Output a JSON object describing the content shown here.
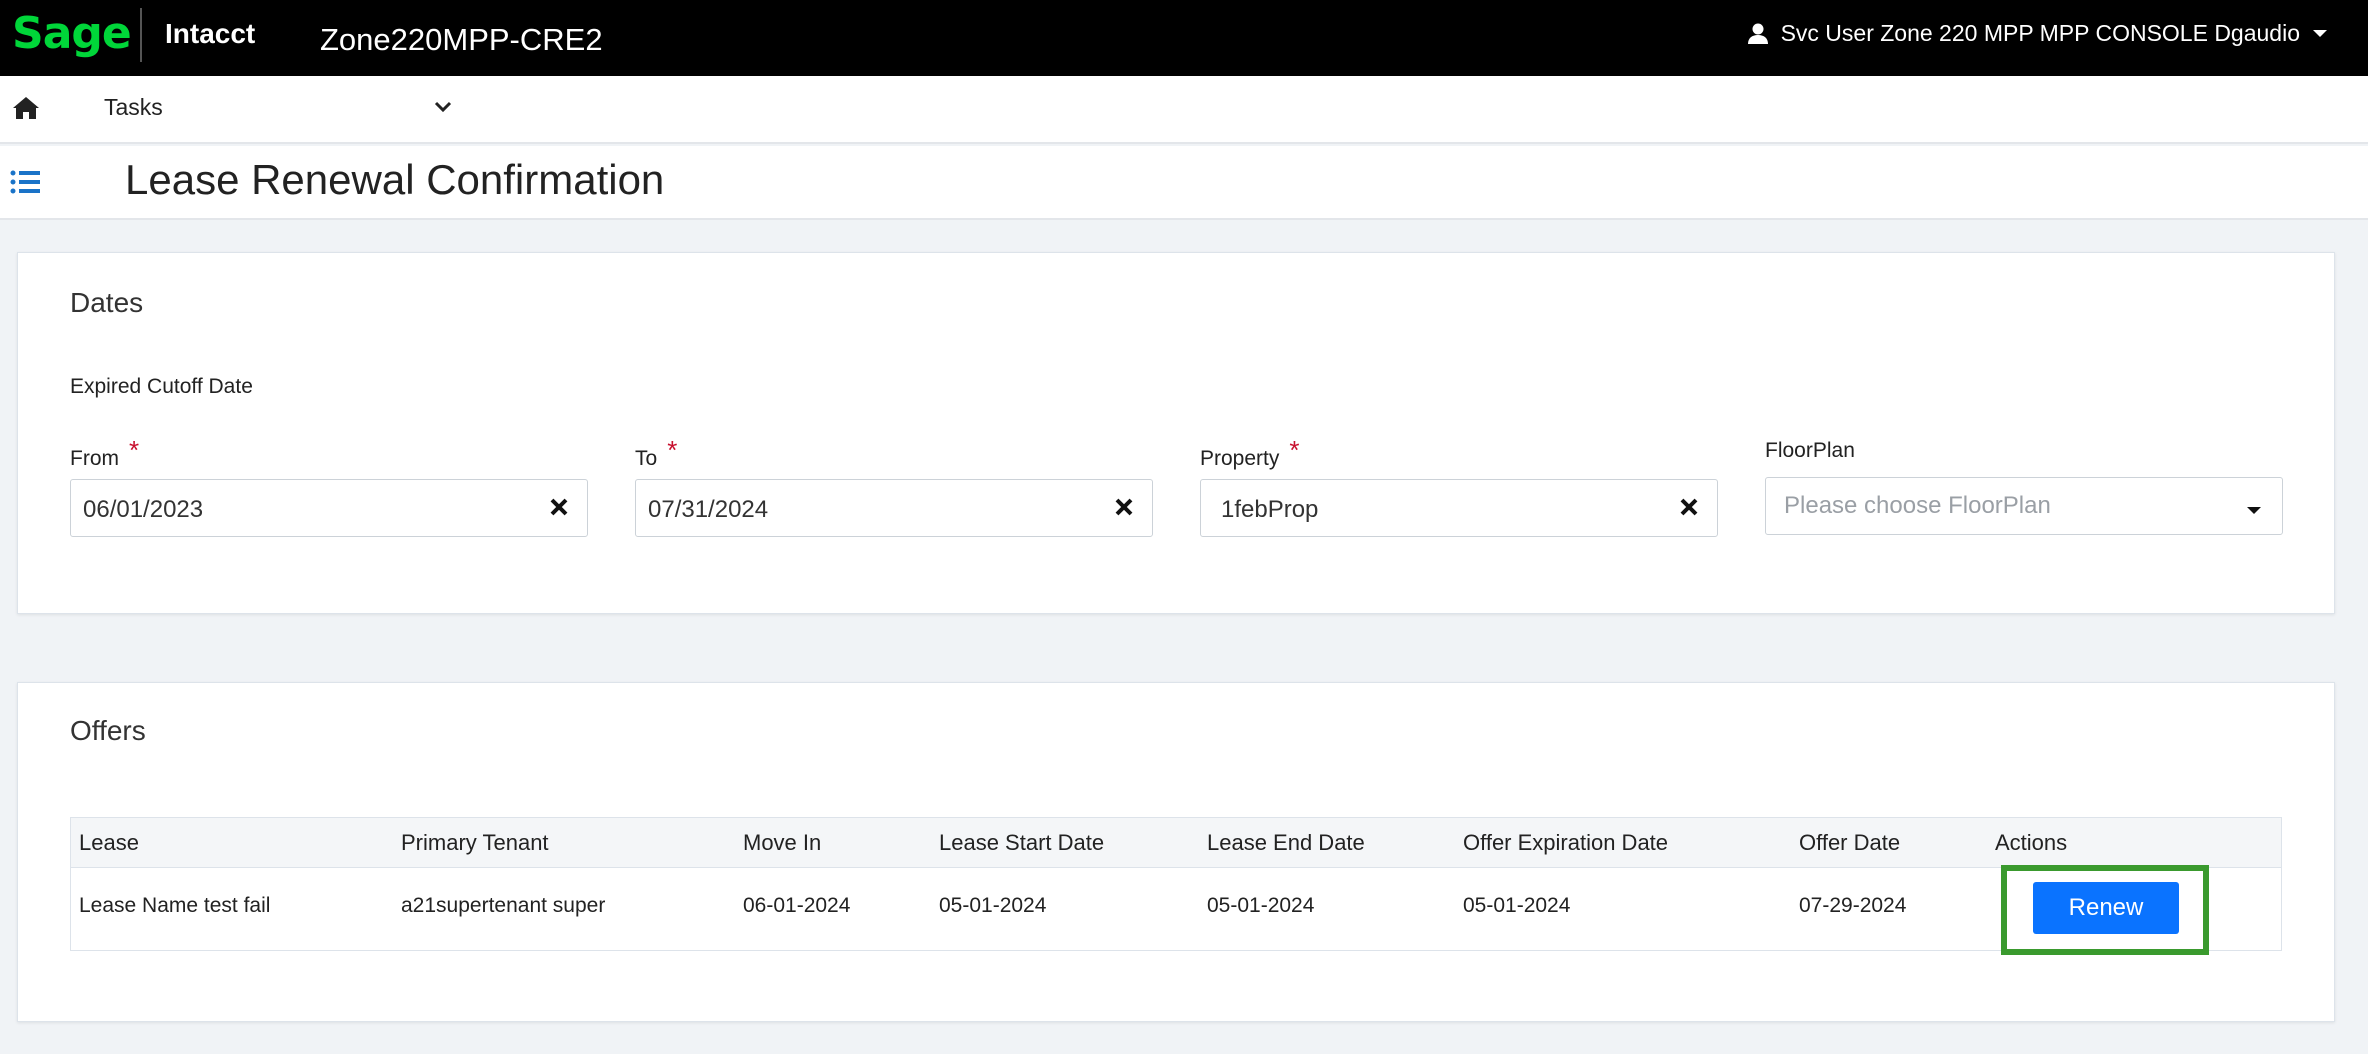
{
  "header": {
    "brand": "Sage",
    "product": "Intacct",
    "company": "Zone220MPP-CRE2",
    "user": "Svc User Zone 220 MPP MPP CONSOLE Dgaudio"
  },
  "nav": {
    "tasks_label": "Tasks"
  },
  "page": {
    "title": "Lease Renewal Confirmation"
  },
  "dates": {
    "title": "Dates",
    "subtitle": "Expired Cutoff Date",
    "from": {
      "label": "From",
      "value": "06/01/2023",
      "required_mark": "*"
    },
    "to": {
      "label": "To",
      "value": "07/31/2024",
      "required_mark": "*"
    },
    "property": {
      "label": "Property",
      "value": "1febProp",
      "required_mark": "*"
    },
    "floorplan": {
      "label": "FloorPlan",
      "placeholder": "Please choose FloorPlan"
    }
  },
  "offers": {
    "title": "Offers",
    "columns": [
      "Lease",
      "Primary Tenant",
      "Move In",
      "Lease Start Date",
      "Lease End Date",
      "Offer Expiration Date",
      "Offer Date",
      "Actions"
    ],
    "rows": [
      {
        "lease": "Lease Name test fail",
        "tenant": "a21supertenant super",
        "move_in": "06-01-2024",
        "lease_start": "05-01-2024",
        "lease_end": "05-01-2024",
        "offer_expiration": "05-01-2024",
        "offer_date": "07-29-2024",
        "action_label": "Renew"
      }
    ]
  },
  "colors": {
    "brand_green": "#00d639",
    "primary_button": "#0a73ff",
    "highlight_border": "#3a9a2e",
    "required": "#c8102e",
    "menu_icon": "#1a73c8"
  },
  "icons": [
    "user-icon",
    "caret-down-icon",
    "home-icon",
    "chevron-down-icon",
    "list-icon",
    "clear-icon"
  ]
}
